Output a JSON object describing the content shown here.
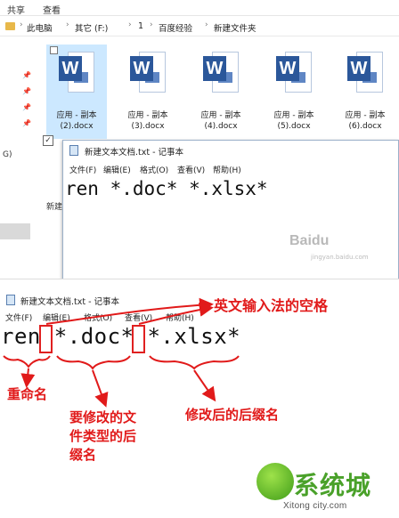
{
  "explorer": {
    "ribbon_tabs": [
      "共享",
      "查看"
    ],
    "breadcrumb": [
      "此电脑",
      "其它 (F:)",
      "1",
      "百度经验",
      "新建文件夹"
    ],
    "nav_label": "G)",
    "files": [
      {
        "label1": "应用 - 副本",
        "label2": "(2).docx"
      },
      {
        "label1": "应用 - 副本",
        "label2": "(3).docx"
      },
      {
        "label1": "应用 - 副本",
        "label2": "(4).docx"
      },
      {
        "label1": "应用 - 副本",
        "label2": "(5).docx"
      },
      {
        "label1": "应用 - 副本",
        "label2": "(6).docx"
      }
    ],
    "partial_item": "新建",
    "checkbox_mark": "✓"
  },
  "notepad_top": {
    "title": "新建文本文档.txt - 记事本",
    "menu": [
      "文件(F)",
      "编辑(E)",
      "格式(O)",
      "查看(V)",
      "帮助(H)"
    ],
    "content": "ren *.doc* *.xlsx*"
  },
  "watermark": {
    "text": "Baidu",
    "sub": "jingyan.baidu.com"
  },
  "notepad_bottom": {
    "title": "新建文本文档.txt - 记事本",
    "menu": [
      "文件(F)",
      "编辑(E)",
      "格式(O)",
      "查看(V)",
      "帮助(H)"
    ],
    "content": "ren *.doc* *.xlsx*"
  },
  "annotations": {
    "space_note": "英文输入法的空格",
    "command": "重命名",
    "old_type_l1": "要修改的文",
    "old_type_l2": "件类型的后",
    "old_type_l3": "缀名",
    "new_suffix": "修改后的后缀名"
  },
  "logo": {
    "text": "系统城",
    "url": "Xitong city.com"
  },
  "colors": {
    "annotation": "#e11a1a",
    "word_blue": "#2b579a",
    "selection": "#cce8ff"
  }
}
